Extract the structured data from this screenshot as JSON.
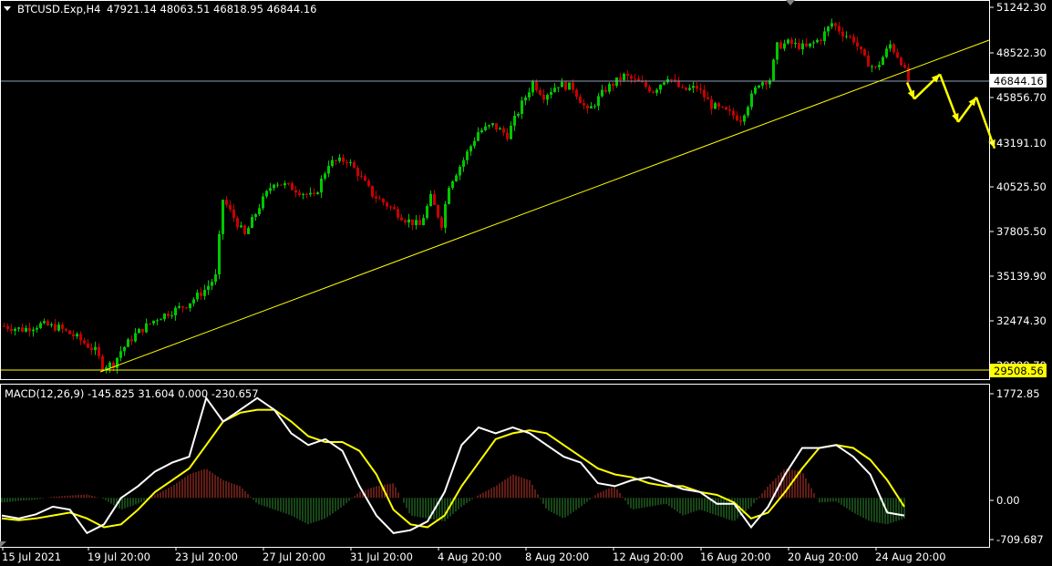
{
  "main_chart": {
    "symbol_timeframe": "BTCUSD.Exp,H4",
    "ohlc": "47921.14 48063.51 46818.95 46844.16",
    "price_axis_labels": [
      "51242.30",
      "48522.30",
      "45856.70",
      "43191.10",
      "40525.50",
      "37805.50",
      "35139.90",
      "32474.30",
      "29808.70"
    ],
    "current_price_tag": "46844.16",
    "support_price_tag": "29508.56"
  },
  "macd_panel": {
    "indicator_label": "MACD(12,26,9) -145.825 31.604 0.000 -230.657",
    "axis_labels": [
      "1772.85",
      "0.00",
      "-709.687"
    ]
  },
  "time_axis_labels": [
    "15 Jul 2021",
    "19 Jul 20:00",
    "23 Jul 20:00",
    "27 Jul 20:00",
    "31 Jul 20:00",
    "4 Aug 20:00",
    "8 Aug 20:00",
    "12 Aug 20:00",
    "16 Aug 20:00",
    "20 Aug 20:00",
    "24 Aug 20:00"
  ],
  "colors": {
    "background": "#000000",
    "bull_candle": "#00c800",
    "bear_candle": "#c80000",
    "trendline": "#ffff00",
    "forecast_arrow": "#ffff00",
    "horizontal_price_line": "#8ea0b8",
    "macd_main_line": "#ffffff",
    "macd_signal_line": "#ffff00",
    "hist_positive": "#c0392b",
    "hist_negative": "#2e8b2e",
    "grid_text": "#ffffff"
  },
  "chart_data": [
    {
      "type": "candlestick",
      "title": "BTCUSD.Exp,H4",
      "ylim": [
        29000,
        51700
      ],
      "x_ticks": [
        "15 Jul 2021",
        "19 Jul 20:00",
        "23 Jul 20:00",
        "27 Jul 20:00",
        "31 Jul 20:00",
        "4 Aug 20:00",
        "8 Aug 20:00",
        "12 Aug 20:00",
        "16 Aug 20:00",
        "20 Aug 20:00",
        "24 Aug 20:00"
      ],
      "close_path_points": [
        [
          0,
          32000
        ],
        [
          5,
          31800
        ],
        [
          10,
          32100
        ],
        [
          15,
          31900
        ],
        [
          20,
          31300
        ],
        [
          25,
          30500
        ],
        [
          27,
          29600
        ],
        [
          30,
          29700
        ],
        [
          32,
          30500
        ],
        [
          36,
          31500
        ],
        [
          42,
          32500
        ],
        [
          50,
          33300
        ],
        [
          55,
          34200
        ],
        [
          58,
          35000
        ],
        [
          60,
          39700
        ],
        [
          63,
          38600
        ],
        [
          66,
          37500
        ],
        [
          70,
          39300
        ],
        [
          74,
          40800
        ],
        [
          79,
          40400
        ],
        [
          85,
          39800
        ],
        [
          89,
          41900
        ],
        [
          94,
          42100
        ],
        [
          97,
          41300
        ],
        [
          101,
          40000
        ],
        [
          106,
          39200
        ],
        [
          110,
          38500
        ],
        [
          114,
          38100
        ],
        [
          117,
          39800
        ],
        [
          120,
          38200
        ],
        [
          122,
          40600
        ],
        [
          126,
          42100
        ],
        [
          130,
          43800
        ],
        [
          134,
          44200
        ],
        [
          138,
          43600
        ],
        [
          142,
          45500
        ],
        [
          145,
          46800
        ],
        [
          148,
          46000
        ],
        [
          152,
          46700
        ],
        [
          156,
          46500
        ],
        [
          160,
          45000
        ],
        [
          165,
          46400
        ],
        [
          170,
          47200
        ],
        [
          174,
          46800
        ],
        [
          178,
          46300
        ],
        [
          182,
          47200
        ],
        [
          186,
          46300
        ],
        [
          190,
          46500
        ],
        [
          194,
          45400
        ],
        [
          198,
          45000
        ],
        [
          202,
          44600
        ],
        [
          204,
          45500
        ],
        [
          207,
          46800
        ],
        [
          210,
          47000
        ],
        [
          212,
          49000
        ],
        [
          215,
          49200
        ],
        [
          220,
          48900
        ],
        [
          224,
          49500
        ],
        [
          227,
          50400
        ],
        [
          230,
          49800
        ],
        [
          233,
          49400
        ],
        [
          236,
          48200
        ],
        [
          239,
          47600
        ],
        [
          243,
          49100
        ],
        [
          246,
          48100
        ],
        [
          248,
          46844
        ]
      ],
      "horizontal_lines": [
        46844.16,
        29508.56
      ],
      "trendline": {
        "from": [
          27,
          29508
        ],
        "to": [
          270,
          49050
        ]
      },
      "forecast_zigzag": [
        [
          248,
          46800
        ],
        [
          250,
          45800
        ],
        [
          257,
          47300
        ],
        [
          262,
          44400
        ],
        [
          267,
          45900
        ],
        [
          272,
          42800
        ]
      ]
    },
    {
      "type": "line",
      "title": "MACD(12,26,9) -145.825 31.604 0.000 -230.657",
      "ylim": [
        -709.687,
        1772.85
      ],
      "series": [
        {
          "name": "MACD",
          "values": [
            -300,
            -350,
            -280,
            -150,
            -200,
            -600,
            -450,
            0,
            200,
            450,
            600,
            700,
            1700,
            1300,
            1500,
            1700,
            1500,
            1100,
            900,
            1000,
            800,
            200,
            -300,
            -600,
            -550,
            -400,
            100,
            900,
            1200,
            1100,
            1200,
            1100,
            900,
            700,
            600,
            250,
            200,
            300,
            350,
            250,
            150,
            100,
            -100,
            -100,
            -500,
            -150,
            400,
            850,
            850,
            900,
            700,
            400,
            -250,
            -300
          ]
        },
        {
          "name": "Signal",
          "values": [
            -350,
            -380,
            -350,
            -300,
            -250,
            -350,
            -500,
            -450,
            -200,
            100,
            300,
            500,
            900,
            1300,
            1450,
            1500,
            1500,
            1300,
            1050,
            950,
            950,
            800,
            400,
            -200,
            -450,
            -500,
            -300,
            200,
            600,
            1000,
            1100,
            1150,
            1100,
            900,
            700,
            500,
            400,
            350,
            250,
            200,
            200,
            100,
            50,
            -80,
            -350,
            -250,
            100,
            500,
            850,
            900,
            850,
            650,
            300,
            -150
          ]
        },
        {
          "name": "Histogram",
          "values": [
            -80,
            -50,
            -30,
            20,
            40,
            60,
            -20,
            -200,
            -100,
            50,
            200,
            400,
            500,
            300,
            200,
            -100,
            -200,
            -300,
            -450,
            -350,
            -150,
            100,
            200,
            250,
            -300,
            -350,
            -400,
            -150,
            50,
            200,
            400,
            300,
            -200,
            -350,
            -150,
            80,
            200,
            -200,
            -150,
            -100,
            -300,
            -200,
            -300,
            -400,
            -150,
            200,
            500,
            450,
            -80,
            -60,
            -250,
            -400,
            -450,
            -350
          ]
        }
      ]
    }
  ]
}
